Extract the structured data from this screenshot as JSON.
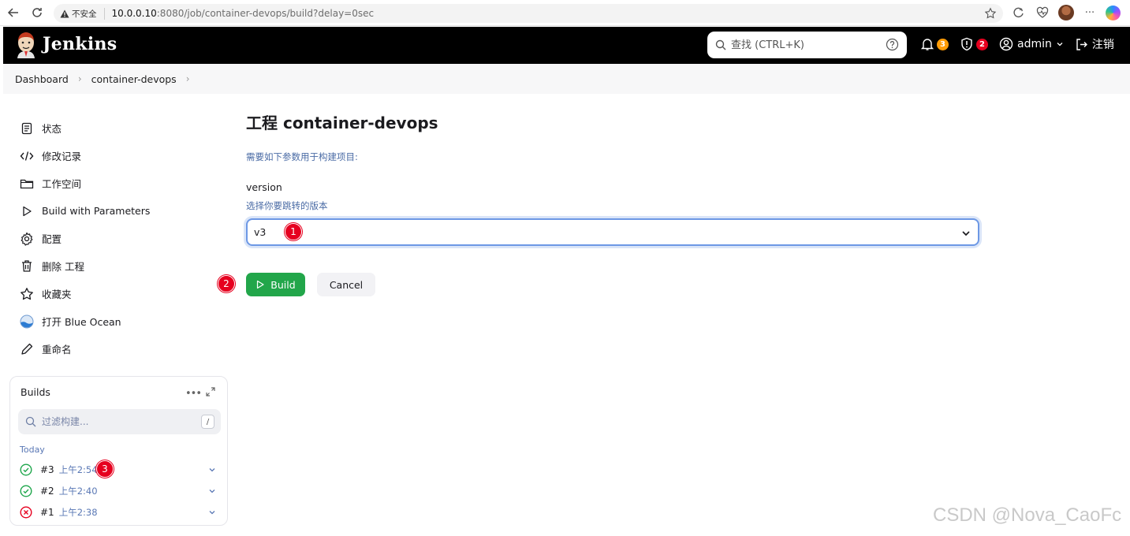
{
  "browser": {
    "insecure_label": "不安全",
    "url_host": "10.0.0.10",
    "url_rest": ":8080/job/container-devops/build?delay=0sec"
  },
  "header": {
    "brand": "Jenkins",
    "search_placeholder": "查找 (CTRL+K)",
    "notifications_count": "3",
    "security_count": "2",
    "user": "admin",
    "logout": "注销"
  },
  "breadcrumb": [
    "Dashboard",
    "container-devops"
  ],
  "sidebar": {
    "items": [
      {
        "label": "状态",
        "icon": "status-icon"
      },
      {
        "label": "修改记录",
        "icon": "code-icon"
      },
      {
        "label": "工作空间",
        "icon": "folder-icon"
      },
      {
        "label": "Build with Parameters",
        "icon": "play-icon"
      },
      {
        "label": "配置",
        "icon": "gear-icon"
      },
      {
        "label": "删除 工程",
        "icon": "trash-icon"
      },
      {
        "label": "收藏夹",
        "icon": "star-icon"
      },
      {
        "label": "打开 Blue Ocean",
        "icon": "blue-ocean-icon"
      },
      {
        "label": "重命名",
        "icon": "pencil-icon"
      }
    ]
  },
  "builds": {
    "title": "Builds",
    "filter_placeholder": "过滤构建...",
    "filter_shortcut": "/",
    "group": "Today",
    "rows": [
      {
        "num": "#3",
        "time": "上午2:54",
        "status": "success"
      },
      {
        "num": "#2",
        "time": "上午2:40",
        "status": "success"
      },
      {
        "num": "#1",
        "time": "上午2:38",
        "status": "failed"
      }
    ]
  },
  "main": {
    "title": "工程 container-devops",
    "description": "需要如下参数用于构建项目:",
    "param_name": "version",
    "param_description": "选择你要跳转的版本",
    "param_value": "v3",
    "build_label": "Build",
    "cancel_label": "Cancel"
  },
  "annotations": [
    "1",
    "2",
    "3"
  ],
  "watermark": "CSDN @Nova_CaoFc",
  "colors": {
    "header_bg": "#000000",
    "build_button": "#22a64a",
    "badge_orange": "#ff9c06",
    "badge_red": "#e6001f",
    "link_blue": "#4a6ba5",
    "success": "#1ea64b",
    "failed": "#e6001f"
  }
}
